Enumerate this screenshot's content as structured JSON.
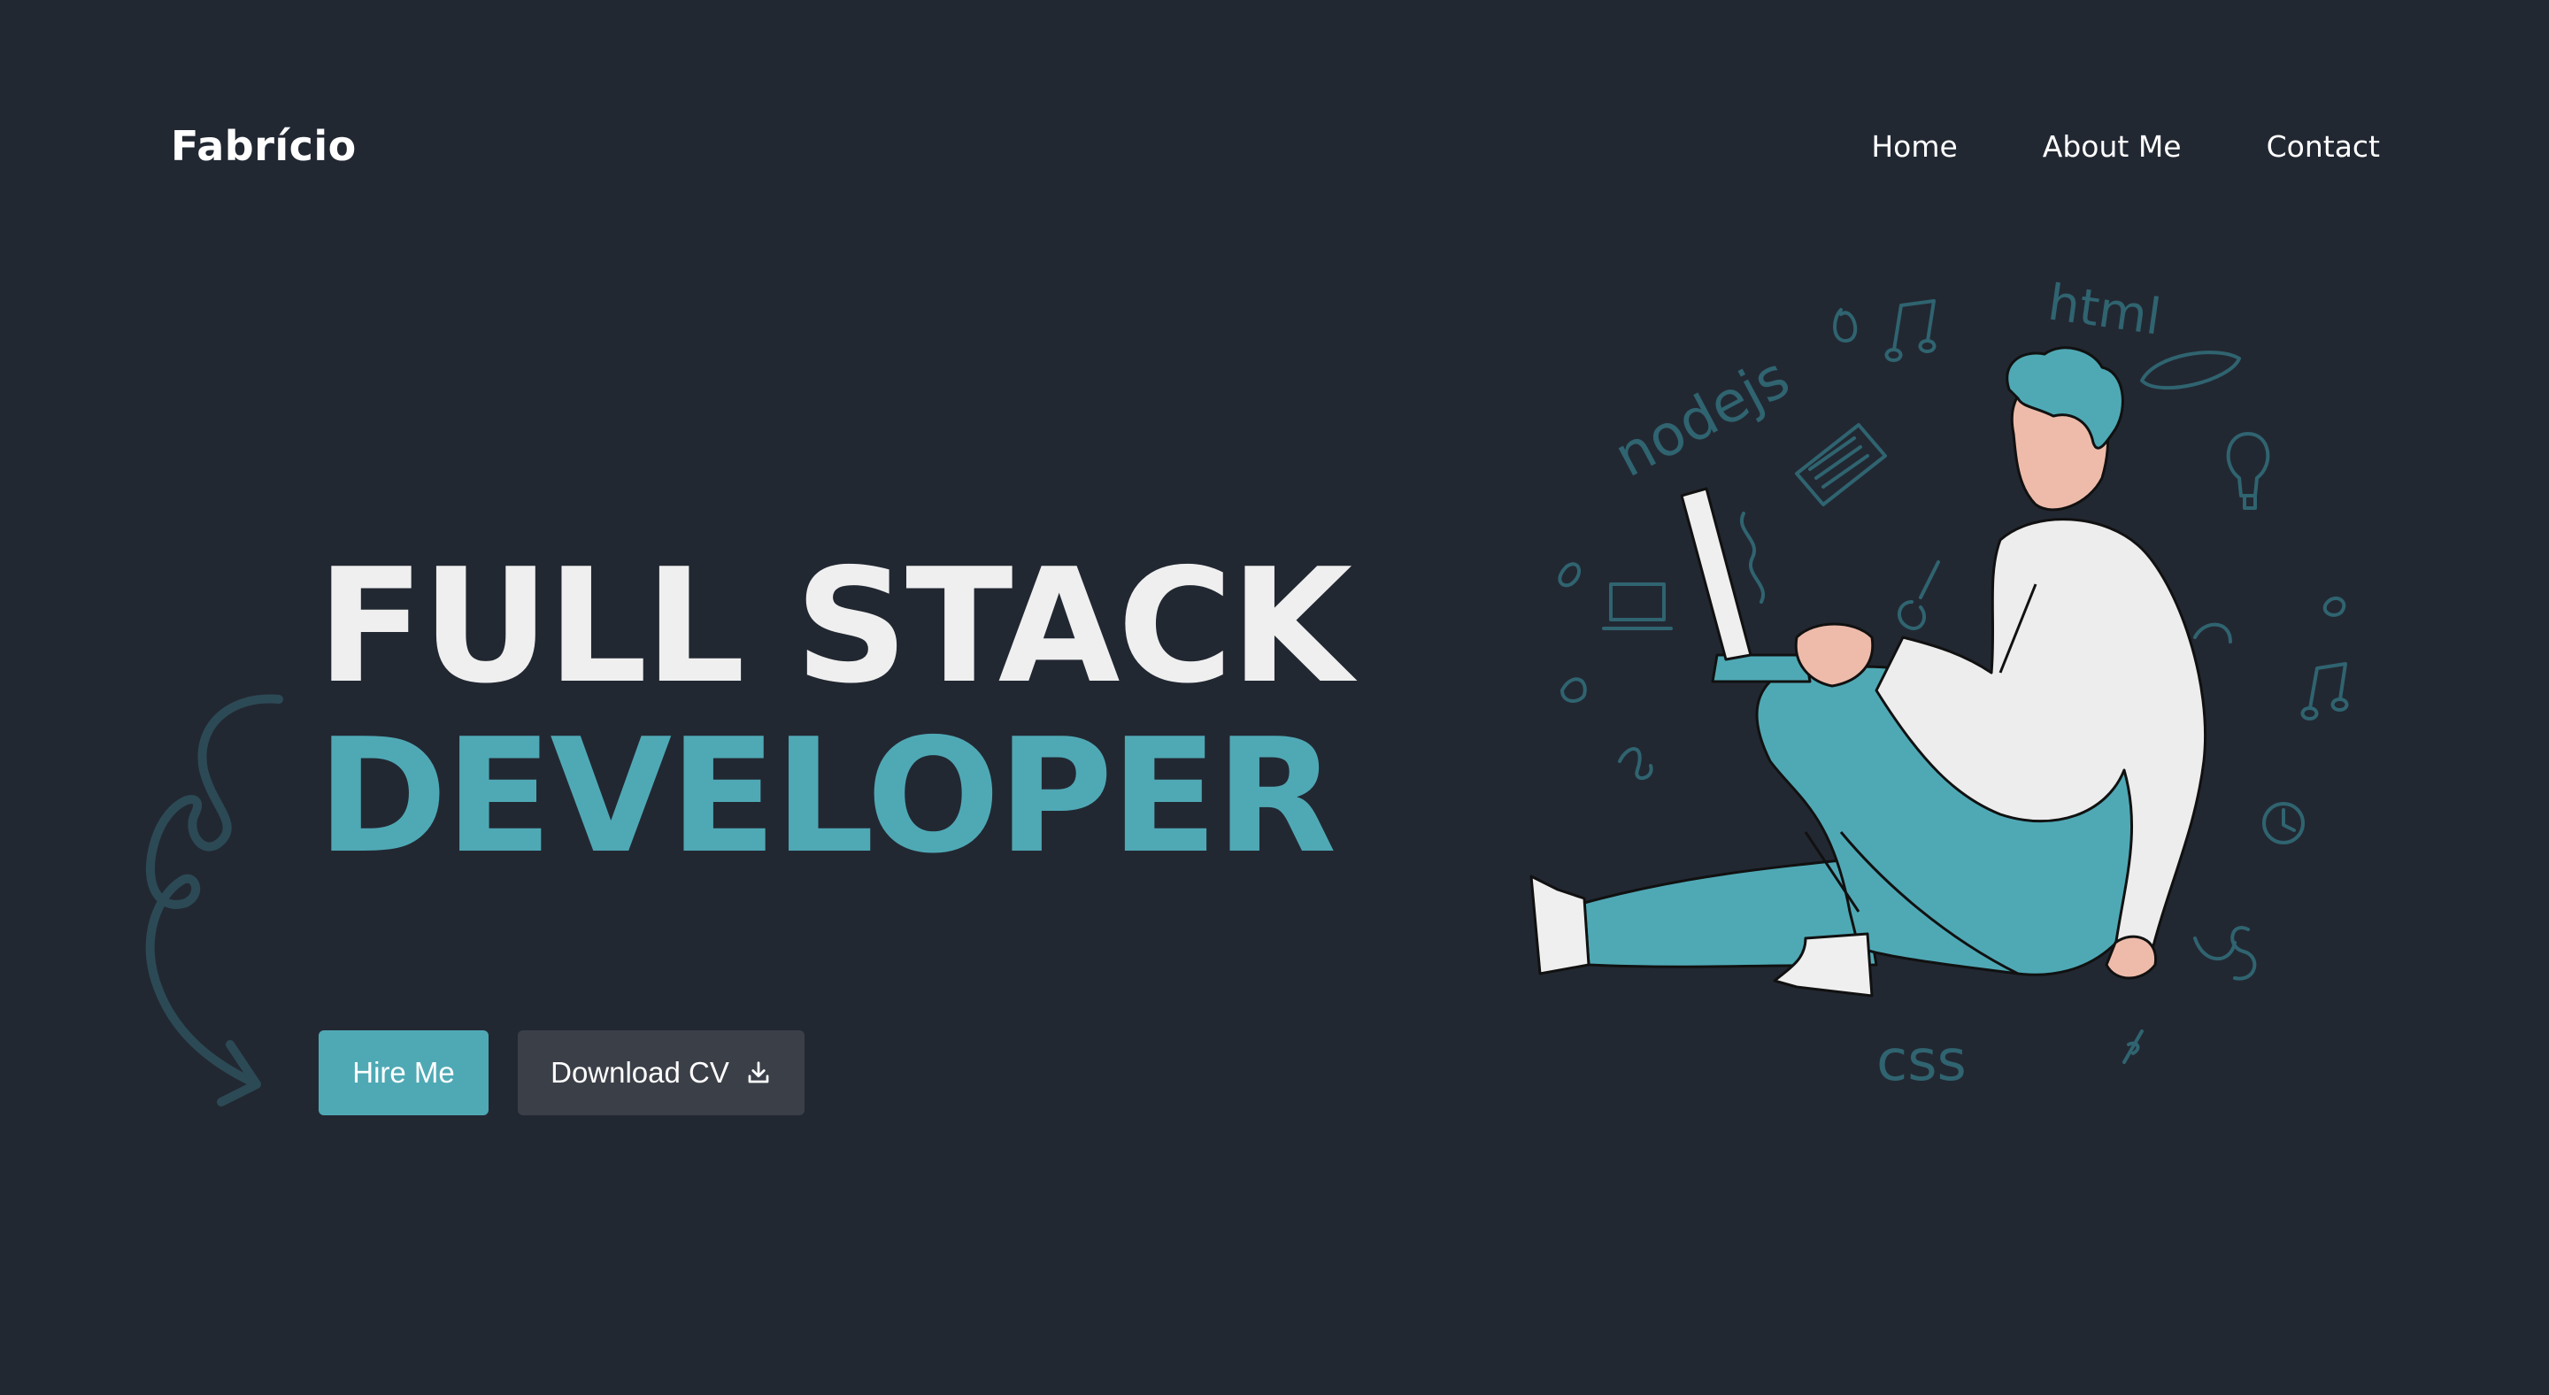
{
  "brand": {
    "name": "Fabrício"
  },
  "nav": {
    "items": [
      {
        "label": "Home"
      },
      {
        "label": "About Me"
      },
      {
        "label": "Contact"
      }
    ]
  },
  "hero": {
    "line1": "FULL STACK",
    "line2": "DEVELOPER",
    "primary_button": "Hire Me",
    "secondary_button": "Download CV",
    "secondary_icon": "download-icon"
  },
  "illustration": {
    "doodles": [
      "html",
      "nodejs",
      "css"
    ]
  },
  "colors": {
    "background": "#222832",
    "accent": "#4fa9b5",
    "secondary_button": "#3b3f48",
    "text": "#efefef"
  }
}
